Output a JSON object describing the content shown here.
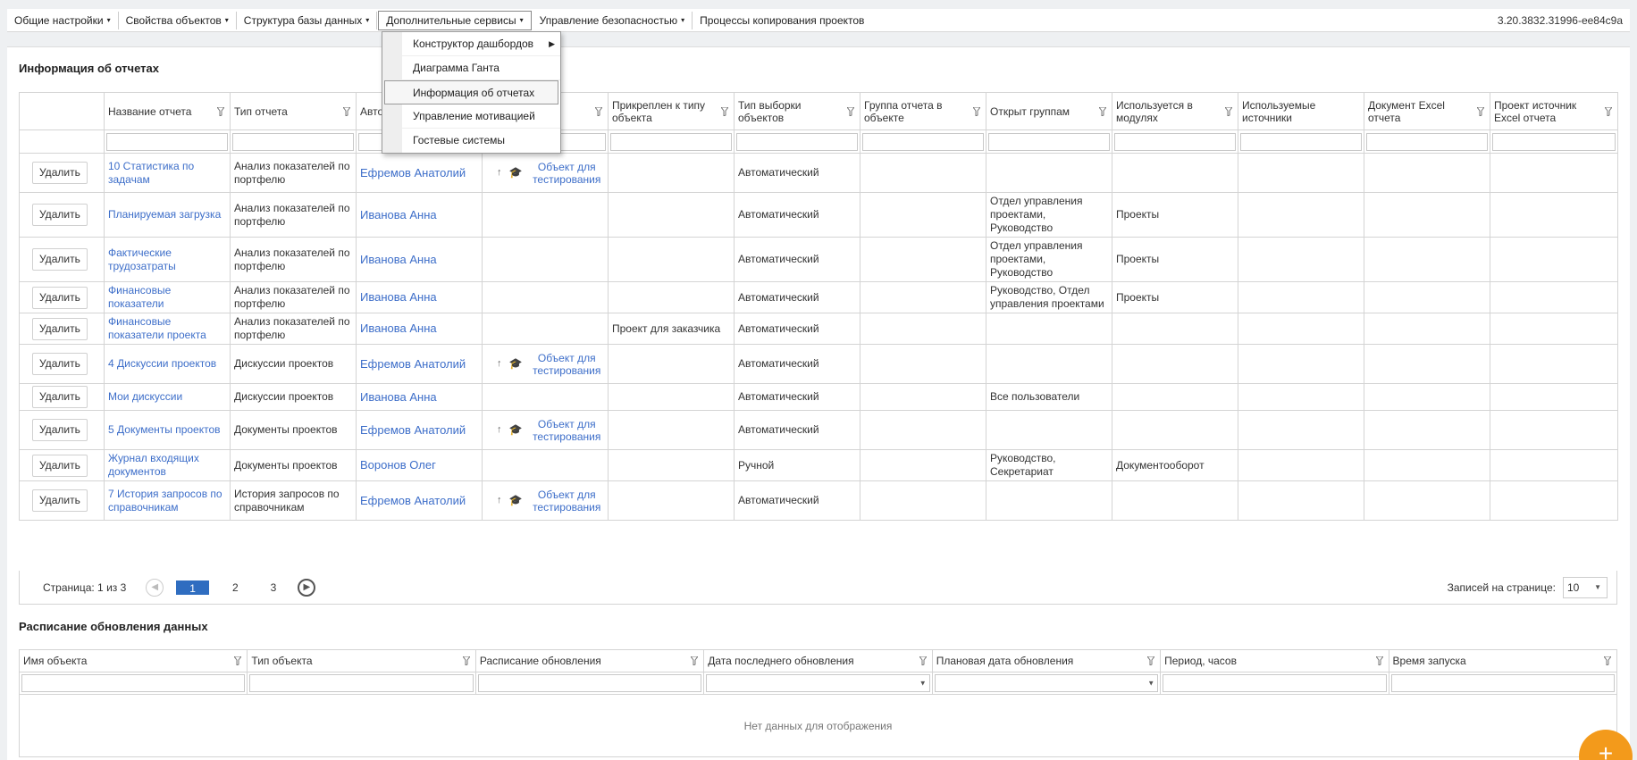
{
  "menubar": {
    "items": [
      {
        "label": "Общие настройки",
        "caret": true
      },
      {
        "label": "Свойства объектов",
        "caret": true
      },
      {
        "label": "Структура базы данных",
        "caret": true
      },
      {
        "label": "Дополнительные сервисы",
        "caret": true
      },
      {
        "label": "Управление безопасностью",
        "caret": true
      },
      {
        "label": "Процессы копирования проектов",
        "caret": false
      }
    ],
    "version": "3.20.3832.31996-ee84c9a"
  },
  "dropdown": {
    "items": [
      {
        "label": "Конструктор дашбордов",
        "submenu": true
      },
      {
        "label": "Диаграмма Ганта"
      },
      {
        "label": "Информация об отчетах"
      },
      {
        "label": "Управление мотивацией"
      },
      {
        "label": "Гостевые системы"
      }
    ]
  },
  "reports": {
    "title": "Информация об отчетах",
    "columns": [
      "",
      "Название отчета",
      "Тип отчета",
      "Авто",
      "",
      "Прикреплен к типу объекта",
      "Тип выборки объектов",
      "Группа отчета в объекте",
      "Открыт группам",
      "Используется в модулях",
      "Используемые источники",
      "Документ Excel отчета",
      "Проект источник Excel отчета"
    ],
    "delete_label": "Удалить",
    "pin_label": "Объект для тестирования",
    "rows": [
      {
        "name": "10 Статистика по задачам",
        "type": "Анализ показателей по портфелю",
        "author": "Ефремов Анатолий",
        "pin": true,
        "attached": "",
        "selection": "Автоматический",
        "group": "",
        "open": "",
        "modules": ""
      },
      {
        "name": "Планируемая загрузка",
        "type": "Анализ показателей по портфелю",
        "author": "Иванова Анна",
        "pin": false,
        "attached": "",
        "selection": "Автоматический",
        "group": "",
        "open": "Отдел управления проектами, Руководство",
        "modules": "Проекты"
      },
      {
        "name": "Фактические трудозатраты",
        "type": "Анализ показателей по портфелю",
        "author": "Иванова Анна",
        "pin": false,
        "attached": "",
        "selection": "Автоматический",
        "group": "",
        "open": "Отдел управления проектами, Руководство",
        "modules": "Проекты"
      },
      {
        "name": "Финансовые показатели",
        "type": "Анализ показателей по портфелю",
        "author": "Иванова Анна",
        "pin": false,
        "attached": "",
        "selection": "Автоматический",
        "group": "",
        "open": "Руководство, Отдел управления проектами",
        "modules": "Проекты"
      },
      {
        "name": "Финансовые показатели проекта",
        "type": "Анализ показателей по портфелю",
        "author": "Иванова Анна",
        "pin": false,
        "attached": "Проект для заказчика",
        "selection": "Автоматический",
        "group": "",
        "open": "",
        "modules": ""
      },
      {
        "name": "4 Дискуссии проектов",
        "type": "Дискуссии проектов",
        "author": "Ефремов Анатолий",
        "pin": true,
        "attached": "",
        "selection": "Автоматический",
        "group": "",
        "open": "",
        "modules": ""
      },
      {
        "name": "Мои дискуссии",
        "type": "Дискуссии проектов",
        "author": "Иванова Анна",
        "pin": false,
        "attached": "",
        "selection": "Автоматический",
        "group": "",
        "open": "Все пользователи",
        "modules": ""
      },
      {
        "name": "5 Документы проектов",
        "type": "Документы проектов",
        "author": "Ефремов Анатолий",
        "pin": true,
        "attached": "",
        "selection": "Автоматический",
        "group": "",
        "open": "",
        "modules": ""
      },
      {
        "name": "Журнал входящих документов",
        "type": "Документы проектов",
        "author": "Воронов Олег",
        "pin": false,
        "attached": "",
        "selection": "Ручной",
        "group": "",
        "open": "Руководство, Секретариат",
        "modules": "Документооборот"
      },
      {
        "name": "7 История запросов по справочникам",
        "type": "История запросов по справочникам",
        "author": "Ефремов Анатолий",
        "pin": true,
        "attached": "",
        "selection": "Автоматический",
        "group": "",
        "open": "",
        "modules": ""
      }
    ]
  },
  "pager": {
    "label": "Страница: 1 из 3",
    "pages": [
      "1",
      "2",
      "3"
    ],
    "per_page_label": "Записей на странице:",
    "per_page_value": "10"
  },
  "schedule": {
    "title": "Расписание обновления данных",
    "columns": [
      "Имя объекта",
      "Тип объекта",
      "Расписание обновления",
      "Дата последнего обновления",
      "Плановая дата обновления",
      "Период, часов",
      "Время запуска"
    ],
    "empty_text": "Нет данных для отображения"
  },
  "fab": {
    "label": "+"
  }
}
